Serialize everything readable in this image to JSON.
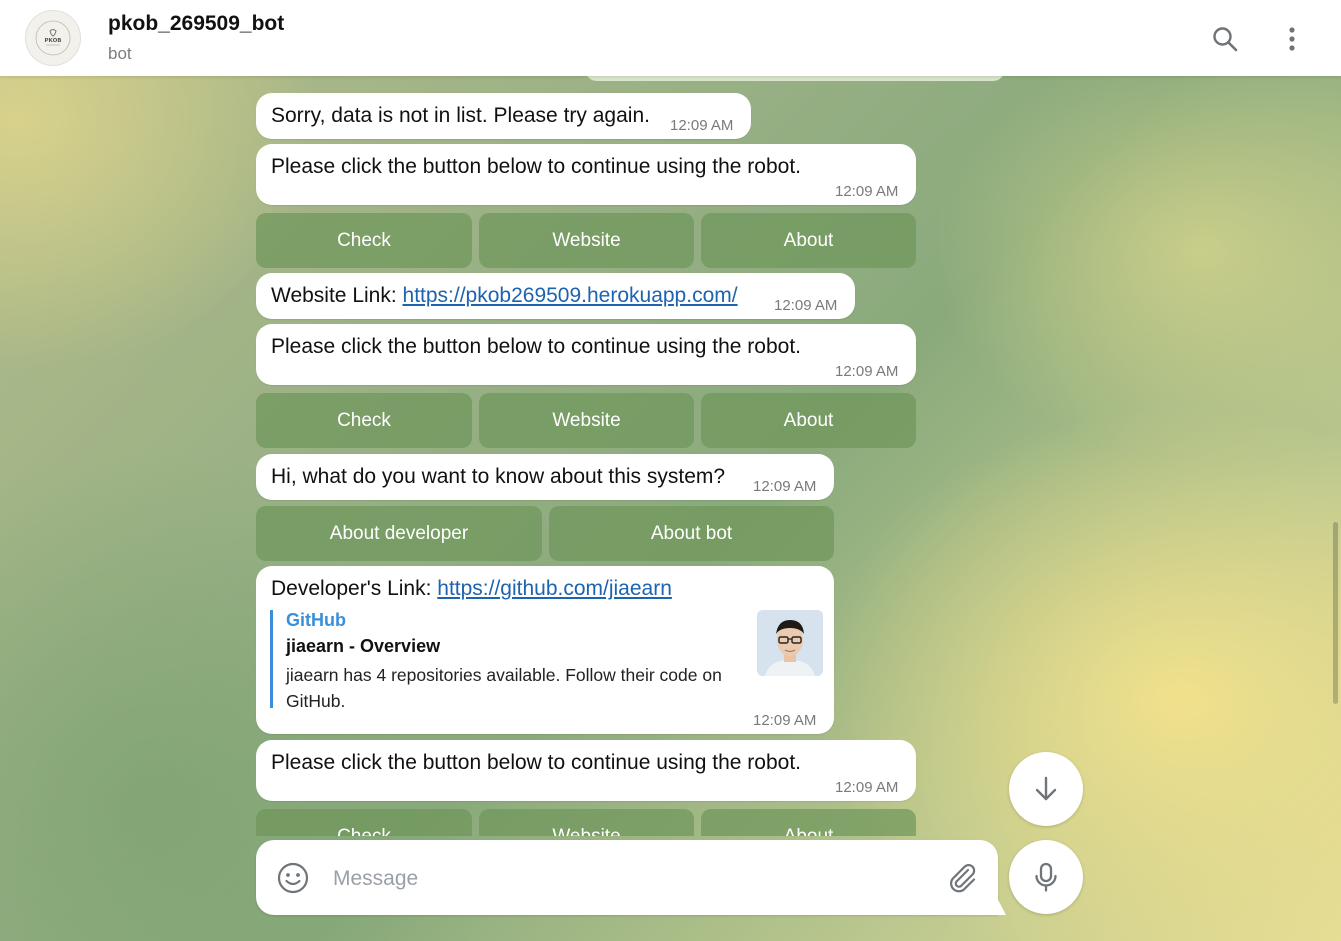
{
  "header": {
    "title": "pkob_269509_bot",
    "subtitle": "bot",
    "avatar_text": "PKOB"
  },
  "messages": [
    {
      "text": "Sorry, data is not in list. Please try again.",
      "time": "12:09 AM"
    },
    {
      "text": "Please click the button below to continue using the robot.",
      "time": "12:09 AM"
    },
    {
      "prefix": "Website Link: ",
      "link": "https://pkob269509.herokuapp.com/",
      "time": "12:09 AM"
    },
    {
      "text": "Please click the button below to continue using the robot.",
      "time": "12:09 AM"
    },
    {
      "text": "Hi, what do you want to know about this system?",
      "time": "12:09 AM"
    },
    {
      "prefix": "Developer's Link: ",
      "link": "https://github.com/jiaearn",
      "time": "12:09 AM",
      "preview": {
        "site": "GitHub",
        "title": "jiaearn - Overview",
        "description": "jiaearn has 4 repositories available. Follow their code on GitHub."
      }
    },
    {
      "text": "Please click the button below to continue using the robot.",
      "time": "12:09 AM"
    }
  ],
  "keyboards": {
    "main": [
      "Check",
      "Website",
      "About"
    ],
    "about": [
      "About developer",
      "About bot"
    ]
  },
  "composer": {
    "placeholder": "Message"
  },
  "colors": {
    "link": "#1d63b0",
    "preview_accent": "#3a8fd8",
    "keyboard_button": "#7f9d6a"
  }
}
